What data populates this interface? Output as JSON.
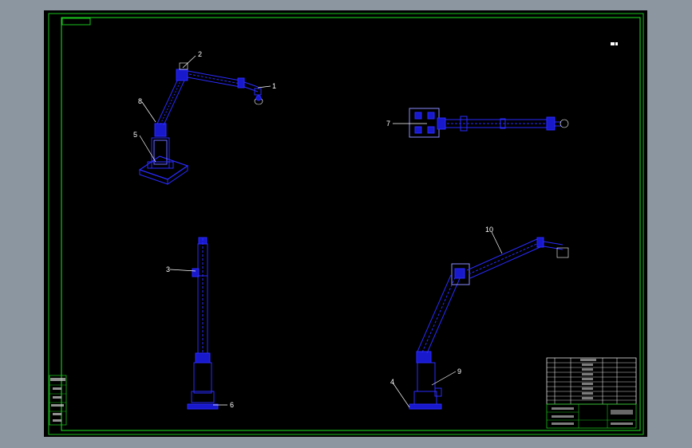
{
  "drawing": {
    "background": "#000000",
    "frame_color": "#19c01b",
    "part_color": "#2a2aff",
    "text_color": "#ffffff",
    "leader_color": "#ffffff"
  },
  "callouts": {
    "c1": "1",
    "c2": "2",
    "c3": "3",
    "c4": "4",
    "c5": "5",
    "c6": "6",
    "c7": "7",
    "c8": "8",
    "c9": "9",
    "c10": "10"
  }
}
